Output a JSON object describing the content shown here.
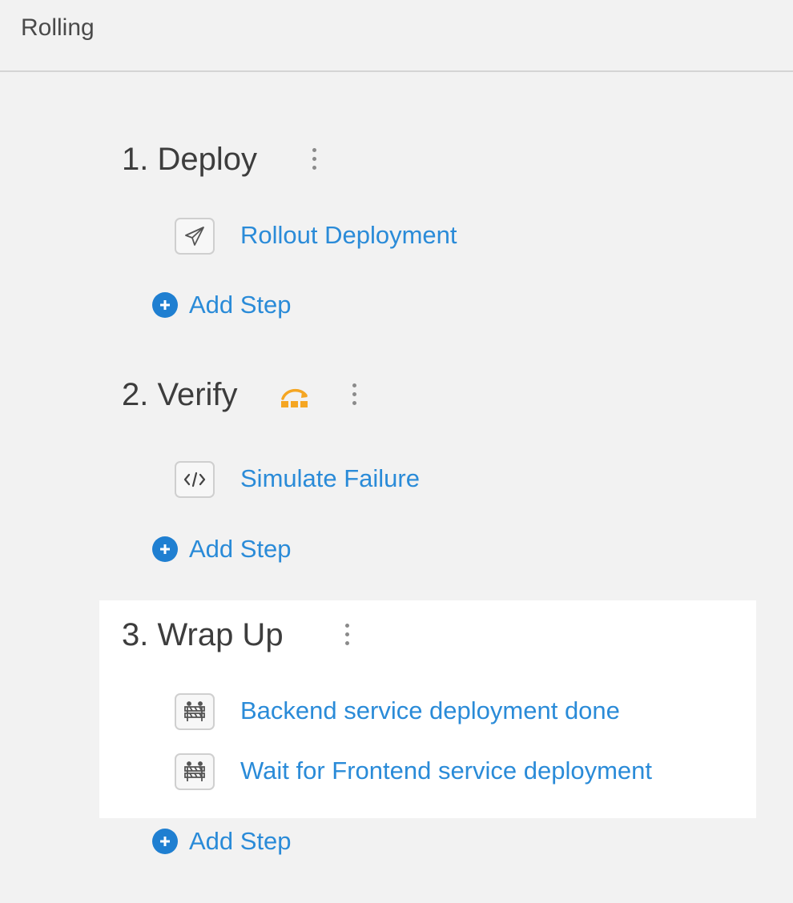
{
  "header": {
    "title": "Rolling"
  },
  "phases": [
    {
      "title": "1. Deploy",
      "steps": [
        {
          "label": "Rollout Deployment",
          "icon": "paper-plane-icon"
        }
      ],
      "add_step_label": "Add Step"
    },
    {
      "title": "2. Verify",
      "badge_icon": "skip-rollback-icon",
      "badge_color": "#f5a623",
      "steps": [
        {
          "label": "Simulate Failure",
          "icon": "code-icon"
        }
      ],
      "add_step_label": "Add Step"
    },
    {
      "title": "3. Wrap Up",
      "steps": [
        {
          "label": "Backend service deployment done",
          "icon": "barrier-icon"
        },
        {
          "label": "Wait for Frontend service deployment",
          "icon": "barrier-icon"
        }
      ],
      "add_step_label": "Add Step"
    }
  ],
  "colors": {
    "link": "#2a8bd8",
    "add_button": "#1f7fd1",
    "background": "#f2f2f2",
    "selected_panel": "#ffffff"
  }
}
